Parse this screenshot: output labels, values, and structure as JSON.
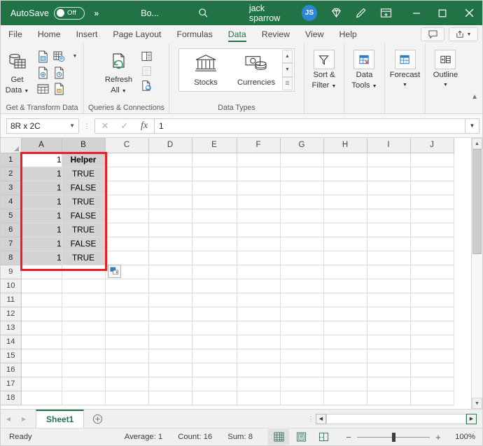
{
  "titlebar": {
    "autosave_label": "AutoSave",
    "autosave_state": "Off",
    "overflow_icon": "chevron-double-right-icon",
    "filename": "Bo...",
    "search_icon": "search-icon",
    "user_name": "jack sparrow",
    "user_initials": "JS",
    "gem_icon": "diamond-icon",
    "pen_icon": "pen-draw-icon",
    "ribbon_display_icon": "ribbon-display-options-icon",
    "minimize_icon": "minimize-icon",
    "maximize_icon": "maximize-icon",
    "close_icon": "close-icon"
  },
  "ribbon": {
    "tabs": [
      {
        "label": "File",
        "active": false
      },
      {
        "label": "Home",
        "active": false
      },
      {
        "label": "Insert",
        "active": false
      },
      {
        "label": "Page Layout",
        "active": false
      },
      {
        "label": "Formulas",
        "active": false
      },
      {
        "label": "Data",
        "active": true
      },
      {
        "label": "Review",
        "active": false
      },
      {
        "label": "View",
        "active": false
      },
      {
        "label": "Help",
        "active": false
      }
    ],
    "comments_icon": "comment-icon",
    "share_icon": "share-icon",
    "share_arrow": "chevron-down-icon",
    "collapse_icon": "collapse-ribbon-icon",
    "groups": [
      {
        "title": "Get & Transform Data",
        "main_button": {
          "label_line1": "Get",
          "label_line2": "Data",
          "icon": "get-data-icon",
          "arrow": "chevron-down-icon"
        },
        "small_icons": [
          "from-text-csv-icon",
          "from-web-icon",
          "from-table-range-icon",
          "from-picture-icon",
          "recent-sources-icon",
          "existing-connections-icon"
        ]
      },
      {
        "title": "Queries & Connections",
        "main_button": {
          "label_line1": "Refresh",
          "label_line2": "All",
          "icon": "refresh-all-icon",
          "arrow": "chevron-down-icon"
        },
        "small_icons": [
          "queries-connections-icon",
          "properties-icon",
          "edit-links-icon"
        ]
      },
      {
        "title": "Data Types",
        "items": [
          {
            "label": "Stocks",
            "icon": "stocks-bank-icon"
          },
          {
            "label": "Currencies",
            "icon": "currencies-money-icon"
          }
        ],
        "scroll_up_icon": "scroll-up-icon",
        "scroll_down_icon": "scroll-down-icon",
        "scroll_more_icon": "more-icon"
      },
      {
        "title": "",
        "buttons": [
          {
            "label_line1": "Sort &",
            "label_line2": "Filter",
            "icon": "filter-funnel-icon",
            "arrow": "chevron-down-icon"
          },
          {
            "label_line1": "Data",
            "label_line2": "Tools",
            "icon": "data-tools-icon",
            "arrow": "chevron-down-icon"
          },
          {
            "label_line1": "Forecast",
            "label_line2": "",
            "icon": "forecast-icon",
            "arrow": "chevron-down-icon"
          },
          {
            "label_line1": "Outline",
            "label_line2": "",
            "icon": "outline-icon",
            "arrow": "chevron-down-icon"
          }
        ]
      }
    ]
  },
  "formula_bar": {
    "name_box_value": "8R x 2C",
    "name_box_arrow": "chevron-down-icon",
    "cancel_icon": "cancel-x-icon",
    "enter_icon": "confirm-check-icon",
    "function_icon": "insert-function-fx-icon",
    "value": "1",
    "expand_icon": "expand-formula-bar-icon"
  },
  "grid": {
    "columns": [
      "A",
      "B",
      "C",
      "D",
      "E",
      "F",
      "G",
      "H",
      "I",
      "J"
    ],
    "selected_columns": [
      "A",
      "B"
    ],
    "rows": [
      1,
      2,
      3,
      4,
      5,
      6,
      7,
      8,
      9,
      10,
      11,
      12,
      13,
      14,
      15,
      16,
      17,
      18
    ],
    "selected_rows": [
      1,
      2,
      3,
      4,
      5,
      6,
      7,
      8
    ],
    "active_cell": "A1",
    "data": [
      {
        "row": 1,
        "A": "1",
        "B": "Helper"
      },
      {
        "row": 2,
        "A": "1",
        "B": "TRUE"
      },
      {
        "row": 3,
        "A": "1",
        "B": "FALSE"
      },
      {
        "row": 4,
        "A": "1",
        "B": "TRUE"
      },
      {
        "row": 5,
        "A": "1",
        "B": "FALSE"
      },
      {
        "row": 6,
        "A": "1",
        "B": "TRUE"
      },
      {
        "row": 7,
        "A": "1",
        "B": "FALSE"
      },
      {
        "row": 8,
        "A": "1",
        "B": "TRUE"
      }
    ],
    "highlight_color": "#ee1c23",
    "paste_options_icon": "paste-options-icon",
    "scroll_up_icon": "scroll-up-icon",
    "scroll_down_icon": "scroll-down-icon"
  },
  "sheet_tabs": {
    "prev_icon": "prev-sheet-icon",
    "next_icon": "next-sheet-icon",
    "tabs": [
      {
        "label": "Sheet1",
        "active": true
      }
    ],
    "add_icon": "add-sheet-icon",
    "hscroll_left_icon": "scroll-left-icon",
    "hscroll_right_icon": "scroll-right-icon"
  },
  "status_bar": {
    "mode": "Ready",
    "stats": [
      "Average: 1",
      "Count: 16",
      "Sum: 8"
    ],
    "views": [
      {
        "name": "normal-view-icon",
        "active": true
      },
      {
        "name": "page-layout-view-icon",
        "active": false
      },
      {
        "name": "page-break-preview-icon",
        "active": false
      }
    ],
    "zoom_out_icon": "zoom-out-icon",
    "zoom_in_icon": "zoom-in-icon",
    "zoom_level": "100%"
  }
}
